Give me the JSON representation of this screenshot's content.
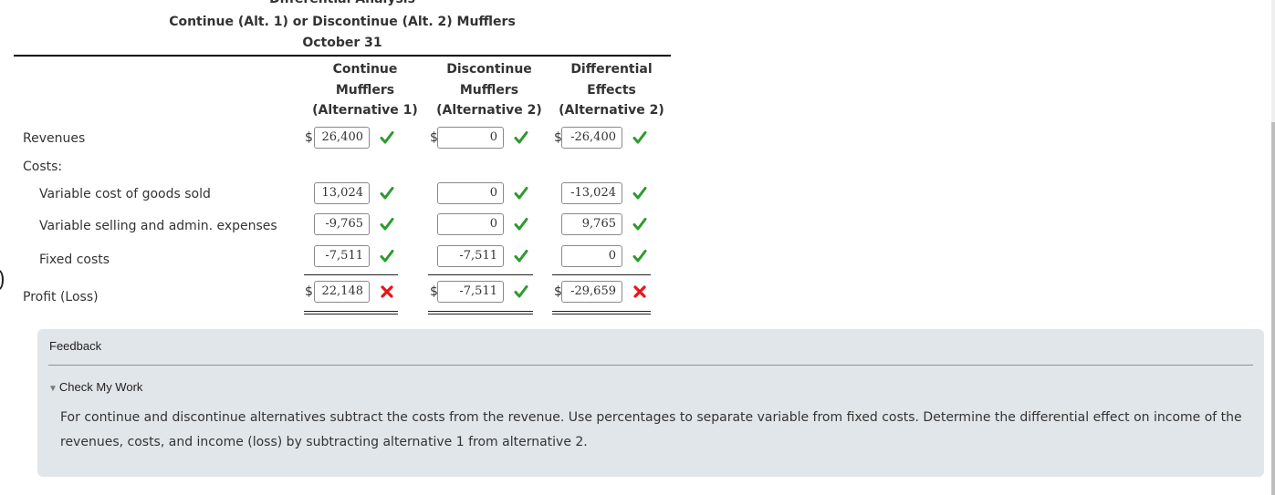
{
  "header": {
    "title": "Differential Analysis",
    "subtitle": "Continue (Alt. 1) or Discontinue (Alt. 2) Mufflers",
    "date": "October 31"
  },
  "columns": [
    {
      "line1": "Continue",
      "line2": "Mufflers",
      "line3": "(Alternative 1)"
    },
    {
      "line1": "Discontinue",
      "line2": "Mufflers",
      "line3": "(Alternative 2)"
    },
    {
      "line1": "Differential",
      "line2": "Effects",
      "line3": "(Alternative 2)"
    }
  ],
  "currency_symbol": "$",
  "rows": {
    "revenues": {
      "label": "Revenues",
      "values": [
        "26,400",
        "0",
        "-26,400"
      ],
      "status": [
        "correct",
        "correct",
        "correct"
      ]
    },
    "costs_label": "Costs:",
    "variable_cogs": {
      "label": "Variable cost of goods sold",
      "values": [
        "13,024",
        "0",
        "-13,024"
      ],
      "status": [
        "correct",
        "correct",
        "correct"
      ]
    },
    "variable_selling": {
      "label": "Variable selling and admin. expenses",
      "values": [
        "-9,765",
        "0",
        "9,765"
      ],
      "status": [
        "correct",
        "correct",
        "correct"
      ]
    },
    "fixed_costs": {
      "label": "Fixed costs",
      "values": [
        "-7,511",
        "-7,511",
        "0"
      ],
      "status": [
        "correct",
        "correct",
        "correct"
      ]
    },
    "profit_loss": {
      "label": "Profit (Loss)",
      "values": [
        "22,148",
        "-7,511",
        "-29,659"
      ],
      "status": [
        "incorrect",
        "correct",
        "incorrect"
      ]
    }
  },
  "status_colors": {
    "correct": "#2e9a2e",
    "incorrect": "#e8141c"
  },
  "feedback": {
    "title": "Feedback",
    "check_my_work": "Check My Work",
    "text": "For continue and discontinue alternatives subtract the costs from the revenue. Use percentages to separate variable from fixed costs. Determine the differential effect on income of the revenues, costs, and income (loss) by subtracting alternative 1 from alternative 2."
  }
}
